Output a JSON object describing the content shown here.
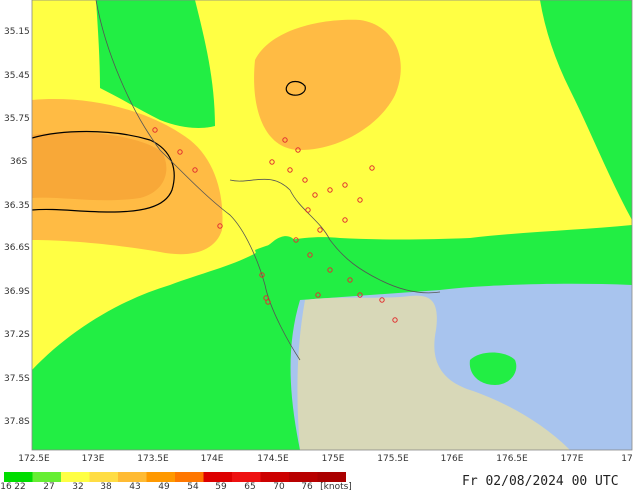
{
  "map": {
    "lat_labels": [
      "35.15",
      "35.45",
      "35.75",
      "36S",
      "36.35",
      "36.6S",
      "36.9S",
      "37.2S",
      "37.5S",
      "37.8S"
    ],
    "lon_labels": [
      "172.5E",
      "173E",
      "173.5E",
      "174E",
      "174.5E",
      "175E",
      "175.5E",
      "176E",
      "176.5E",
      "177E",
      "17"
    ],
    "isobar_label": "o"
  },
  "legend": {
    "labels": [
      "16",
      "22",
      "27",
      "32",
      "38",
      "43",
      "49",
      "54",
      "59",
      "65",
      "70",
      "76"
    ],
    "unit": "[knots]",
    "colors": [
      "#00dd00",
      "#66ee33",
      "#ffff44",
      "#ffdd44",
      "#ffbb33",
      "#ff9900",
      "#ff7700",
      "#dd0000",
      "#ee1111",
      "#cc0000",
      "#b80000",
      "#aa0000"
    ]
  },
  "timestamp": "Fr 02/08/2024 00 UTC",
  "colors": {
    "land_green": "#22ee44",
    "yellow": "#ffff44",
    "orange": "#ffbb44",
    "sea": "#a8c4ee",
    "land_grey": "#d8d8b8"
  }
}
